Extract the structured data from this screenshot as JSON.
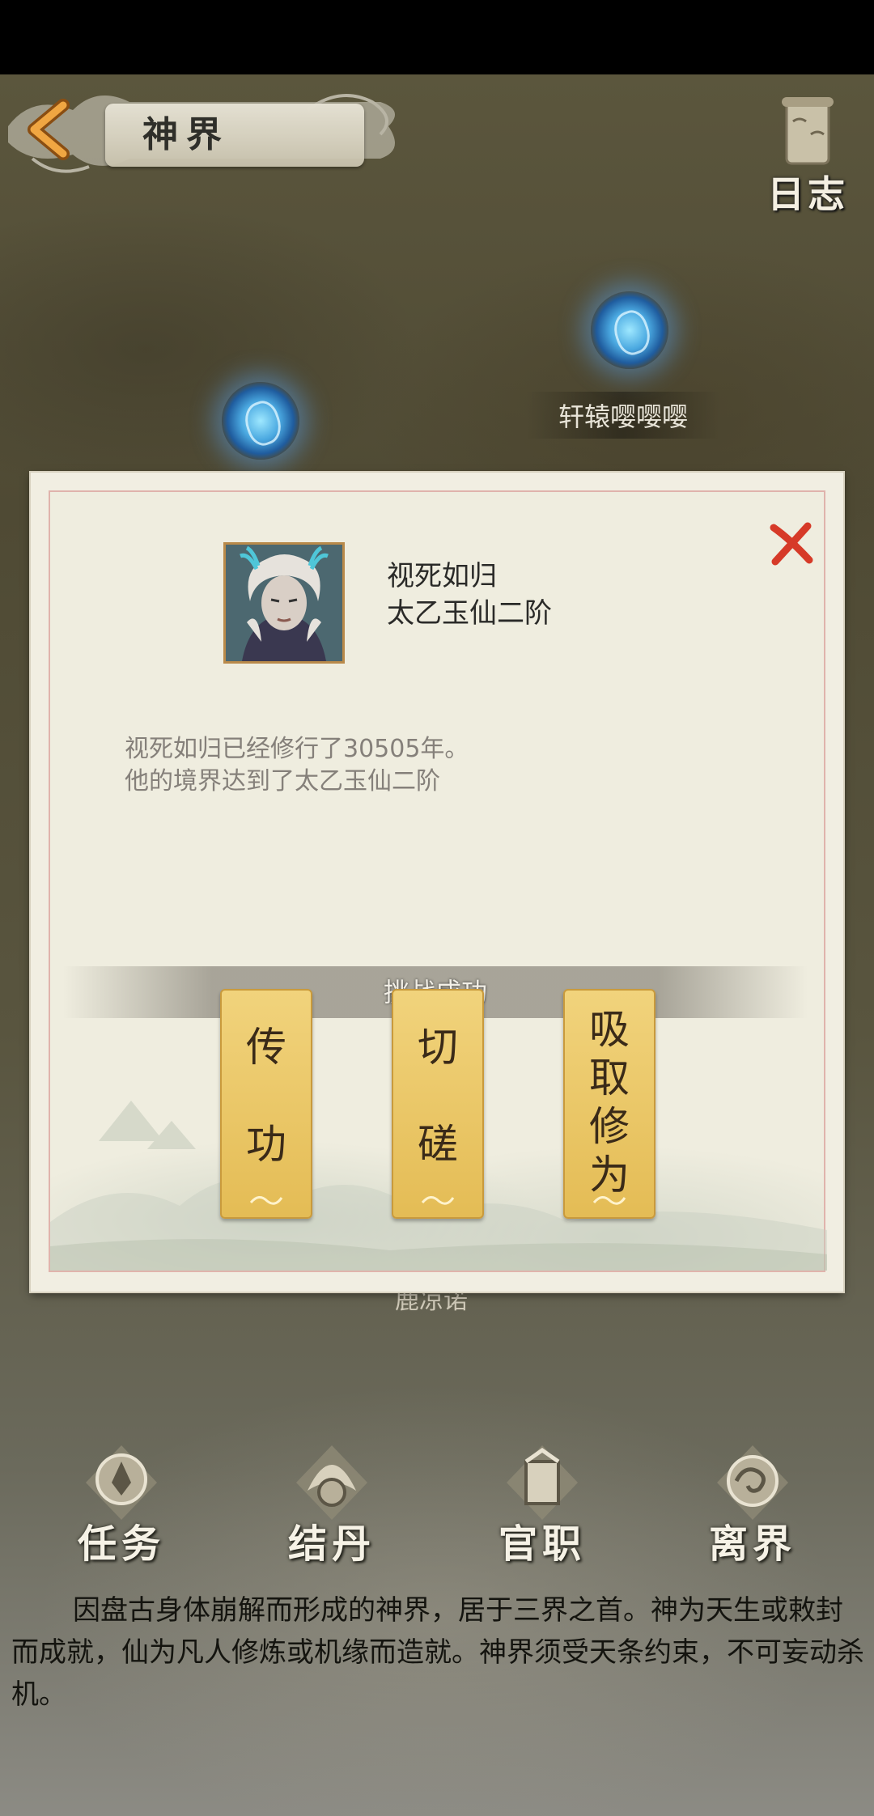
{
  "header": {
    "title": "神界",
    "log_label": "日志"
  },
  "map": {
    "player_name": "轩辕嘤嘤嘤",
    "hidden_name": "鹿凉诺"
  },
  "dialog": {
    "npc_name": "视死如归",
    "npc_rank": "太乙玉仙二阶",
    "desc_line1": "视死如归已经修行了30505年。",
    "desc_line2": "他的境界达到了太乙玉仙二阶",
    "result": "挑战成功",
    "actions": [
      {
        "chars": [
          "传",
          "功"
        ]
      },
      {
        "chars": [
          "切",
          "磋"
        ]
      },
      {
        "chars": [
          "吸",
          "取",
          "修",
          "为"
        ]
      }
    ]
  },
  "nav": [
    {
      "label": "任务",
      "icon": "task-icon"
    },
    {
      "label": "结丹",
      "icon": "dan-icon"
    },
    {
      "label": "官职",
      "icon": "office-icon"
    },
    {
      "label": "离界",
      "icon": "leave-icon"
    }
  ],
  "lore": "因盘古身体崩解而形成的神界，居于三界之首。神为天生或敕封而成就，仙为凡人修炼或机缘而造就。神界须受天条约束，不可妄动杀机。",
  "colors": {
    "button_gold": "#e8c35f",
    "close_red": "#d63a28",
    "orb_blue": "#4aa8e0"
  }
}
